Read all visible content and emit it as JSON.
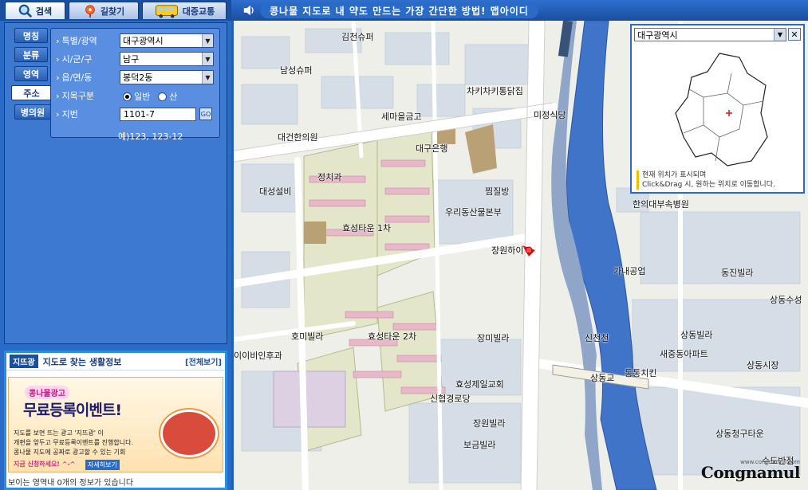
{
  "top_tabs": [
    {
      "label": "검색",
      "icon": "magnifier-icon",
      "active": true
    },
    {
      "label": "길찾기",
      "icon": "map-pin-icon",
      "active": false
    },
    {
      "label": "대중교통",
      "icon": "bus-icon",
      "active": false
    }
  ],
  "side_tabs": [
    "명칭",
    "분류",
    "영역",
    "주소",
    "병의원"
  ],
  "active_side_tab": "주소",
  "form": {
    "city_label": "특별/광역",
    "city_value": "대구광역시",
    "district_label": "시/군/구",
    "district_value": "남구",
    "dong_label": "읍/면/동",
    "dong_value": "봉덕2동",
    "land_label": "지목구분",
    "land_opt_general": "일반",
    "land_opt_mountain": "산",
    "jibun_label": "지번",
    "jibun_value": "1101-7",
    "go_label": "GO",
    "example": "예)123, 123-12"
  },
  "info": {
    "badge": "지뜨광",
    "title": "지도로 찾는 생활정보",
    "view_all": "[전체보기]",
    "banner_badge": "콩나물광고",
    "banner_title": "무료등록이벤트!",
    "banner_lines": [
      "지도를 보면 뜨는 광고 '지뜨광' 이",
      "개편을 앞두고 무료등록이벤트를 진행합니다.",
      "콩나물 지도에 공짜로 광고할 수 있는 기회"
    ],
    "banner_link": "지금 신청하세요! ^-^",
    "banner_cta": "자세히보기",
    "footer": "보이는 영역내      0개의 정보가 있습니다"
  },
  "notice": "콩나물 지도로 내 약도 만드는 가장 간단한 방법! 맵아이디",
  "map_labels": [
    "김천슈퍼",
    "남성슈퍼",
    "차키차키통닭집",
    "세마을금고",
    "미정식당",
    "대건한의원",
    "대구은행",
    "정치과",
    "대성설비",
    "찜질방",
    "우리동산물본부",
    "효성타운 1차",
    "장원하이",
    "효성타운 2차",
    "호미빌라",
    "장미빌라",
    "이이비인후과",
    "효성제일교회",
    "신협경로당",
    "장원빌라",
    "보금빌라",
    "신천천",
    "상동교",
    "통통치킨",
    "새중동아파트",
    "상동빌라",
    "상동시장",
    "가내공업",
    "동진빌라",
    "상동수성",
    "한의대부속병원",
    "상동청구타운",
    "수도반점"
  ],
  "minimap": {
    "region": "대구광역시",
    "close": "✕",
    "note_line1": "현재 위치가 표시되며",
    "note_line2": "Click&Drag 시, 원하는 위치로 이동합니다."
  },
  "logo": "Congnamul",
  "logo_url": "www.congnamul.com",
  "colors": {
    "panel": "#2a6bc7",
    "river": "#3f74c8",
    "road": "#ffffff",
    "apt_area": "#e3e6c8",
    "building": "#cfd9e3"
  }
}
